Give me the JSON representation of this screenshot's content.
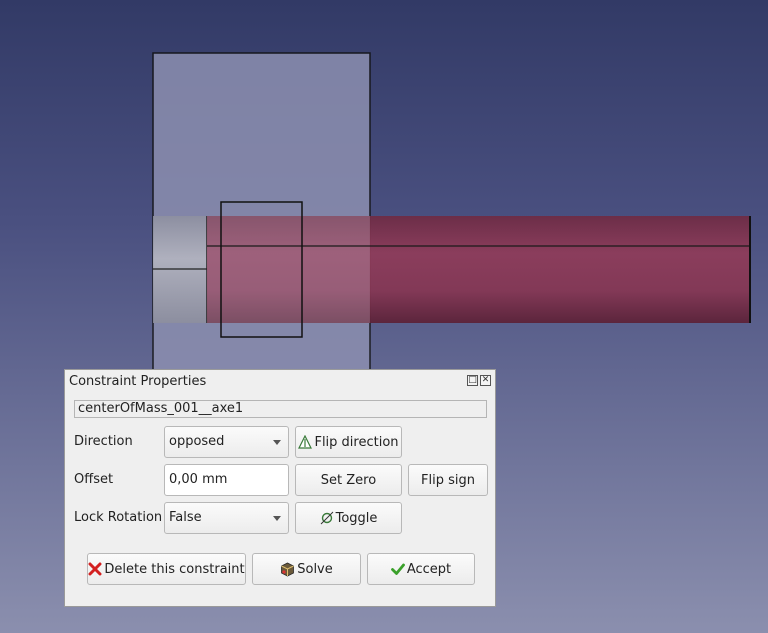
{
  "dialog": {
    "title": "Constraint Properties",
    "name_value": "centerOfMass_001__axe1",
    "direction": {
      "label": "Direction",
      "selected": "opposed",
      "flip_label": "Flip direction"
    },
    "offset": {
      "label": "Offset",
      "value": "0,00 mm",
      "set_zero_label": "Set Zero",
      "flip_sign_label": "Flip sign"
    },
    "lock_rotation": {
      "label": "Lock Rotation",
      "selected": "False",
      "toggle_label": "Toggle"
    },
    "actions": {
      "delete_label": "Delete this constraint",
      "solve_label": "Solve",
      "accept_label": "Accept"
    }
  },
  "icons": {
    "flip": "triangle-warning-icon",
    "toggle": "toggle-circle-icon",
    "delete": "red-x-icon",
    "solve": "solve-cube-icon",
    "accept": "green-check-icon"
  },
  "colors": {
    "rod": "#8a3a56",
    "plate": "#8c8fb0",
    "background_top": "#323a66"
  }
}
